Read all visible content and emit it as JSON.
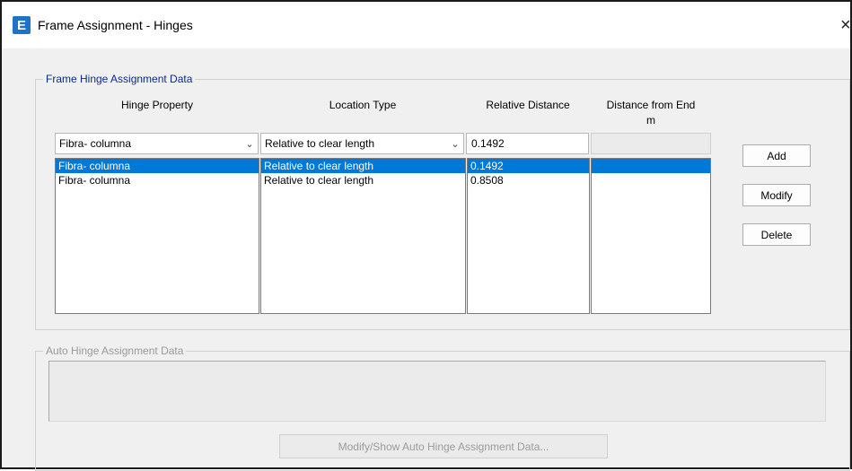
{
  "window": {
    "title": "Frame Assignment - Hinges",
    "app_icon": "E",
    "close_glyph": "×"
  },
  "hinge_group": {
    "legend": "Frame Hinge Assignment Data",
    "headers": {
      "hinge_property": "Hinge Property",
      "location_type": "Location Type",
      "relative_distance": "Relative Distance",
      "distance_from_end": "Distance from End",
      "distance_unit": "m"
    },
    "inputs": {
      "hinge_property": "Fibra- columna",
      "location_type": "Relative to clear length",
      "relative_distance": "0.1492",
      "distance_from_end": ""
    },
    "rows": [
      {
        "hinge_property": "Fibra- columna",
        "location_type": "Relative to clear length",
        "relative_distance": "0.1492",
        "distance_from_end": ""
      },
      {
        "hinge_property": "Fibra- columna",
        "location_type": "Relative to clear length",
        "relative_distance": "0.8508",
        "distance_from_end": ""
      }
    ],
    "selected_row": 0,
    "buttons": {
      "add": "Add",
      "modify": "Modify",
      "delete": "Delete"
    }
  },
  "auto_group": {
    "legend": "Auto Hinge Assignment Data",
    "button": "Modify/Show Auto Hinge Assignment Data..."
  }
}
